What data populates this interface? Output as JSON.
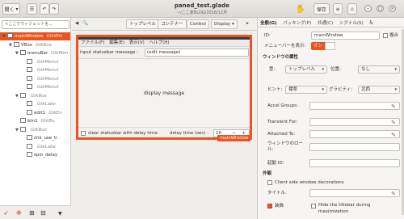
{
  "titlebar": {
    "open_label": "開く",
    "title": "paned_test.glade",
    "subtitle": "~/ここ家BLOG/2018/12月",
    "save_label": "保存"
  },
  "tree": {
    "search_placeholder": "<ここでウィジェットを...",
    "rows": [
      {
        "name": "mainWindow",
        "cls": "GtkWin",
        "indent": 0
      },
      {
        "name": "VBox",
        "cls": "GtkBox",
        "indent": 1
      },
      {
        "name": "menuBar",
        "cls": "GtkMen",
        "indent": 2
      },
      {
        "name": "",
        "cls": "GtkMenuI",
        "indent": 3
      },
      {
        "name": "",
        "cls": "GtkMenuI",
        "indent": 3
      },
      {
        "name": "",
        "cls": "GtkMenuI",
        "indent": 3
      },
      {
        "name": "",
        "cls": "GtkMenuI",
        "indent": 3
      },
      {
        "name": "",
        "cls": "GtkBox",
        "indent": 2
      },
      {
        "name": "",
        "cls": "GtkLabe",
        "indent": 3
      },
      {
        "name": "edit1",
        "cls": "GtkEn",
        "indent": 3
      },
      {
        "name": "btn1",
        "cls": "GtkBu",
        "indent": 2
      },
      {
        "name": "",
        "cls": "GtkBox",
        "indent": 2
      },
      {
        "name": "chk_use_ti",
        "cls": "",
        "indent": 3
      },
      {
        "name": "",
        "cls": "GtkLabe",
        "indent": 3
      },
      {
        "name": "spin_delay",
        "cls": "",
        "indent": 3
      }
    ]
  },
  "palette": {
    "tabs": [
      "トップレベル",
      "コンテナー",
      "Control",
      "Display"
    ]
  },
  "designer": {
    "menu": [
      "ファイル(F)",
      "編集(E)",
      "表示(V)",
      "ヘルプ(H)"
    ],
    "input_label": "input statusbar message :",
    "input_value": "(edit message)",
    "display_text": "display message",
    "clear_label": "clear statusbar with delay time.",
    "delay_label": "delay time (sec) :",
    "delay_value": "10",
    "window_tag": "mainWindow"
  },
  "inspector": {
    "tabs": [
      "全般(G)",
      "パッキング(P)",
      "共通(C)",
      "シグナル(S)"
    ],
    "id_label": "ID:",
    "id_value": "mainWindow",
    "composite_label": "複合",
    "menubar_label": "メニューバーを表示:",
    "toggle_on": "オン",
    "window_props_title": "ウィンドウの属性",
    "type_label": "型:",
    "type_value": "トップレベル",
    "position_label": "位置:",
    "position_value": "なし",
    "hint_label": "ヒント:",
    "hint_value": "標準",
    "gravity_label": "グラビティ:",
    "gravity_value": "北西",
    "accel_label": "Accel Groups:",
    "transient_label": "Transient For:",
    "attached_label": "Attached To:",
    "role_label": "ウィンドウのロール:",
    "startup_label": "起動 ID:",
    "appearance_title": "外観",
    "client_deco_label": "Client side window decorations",
    "title_label": "タイトル:",
    "decorated_label": "装飾",
    "hide_titlebar_label": "Hide the titlebar during maximization"
  }
}
